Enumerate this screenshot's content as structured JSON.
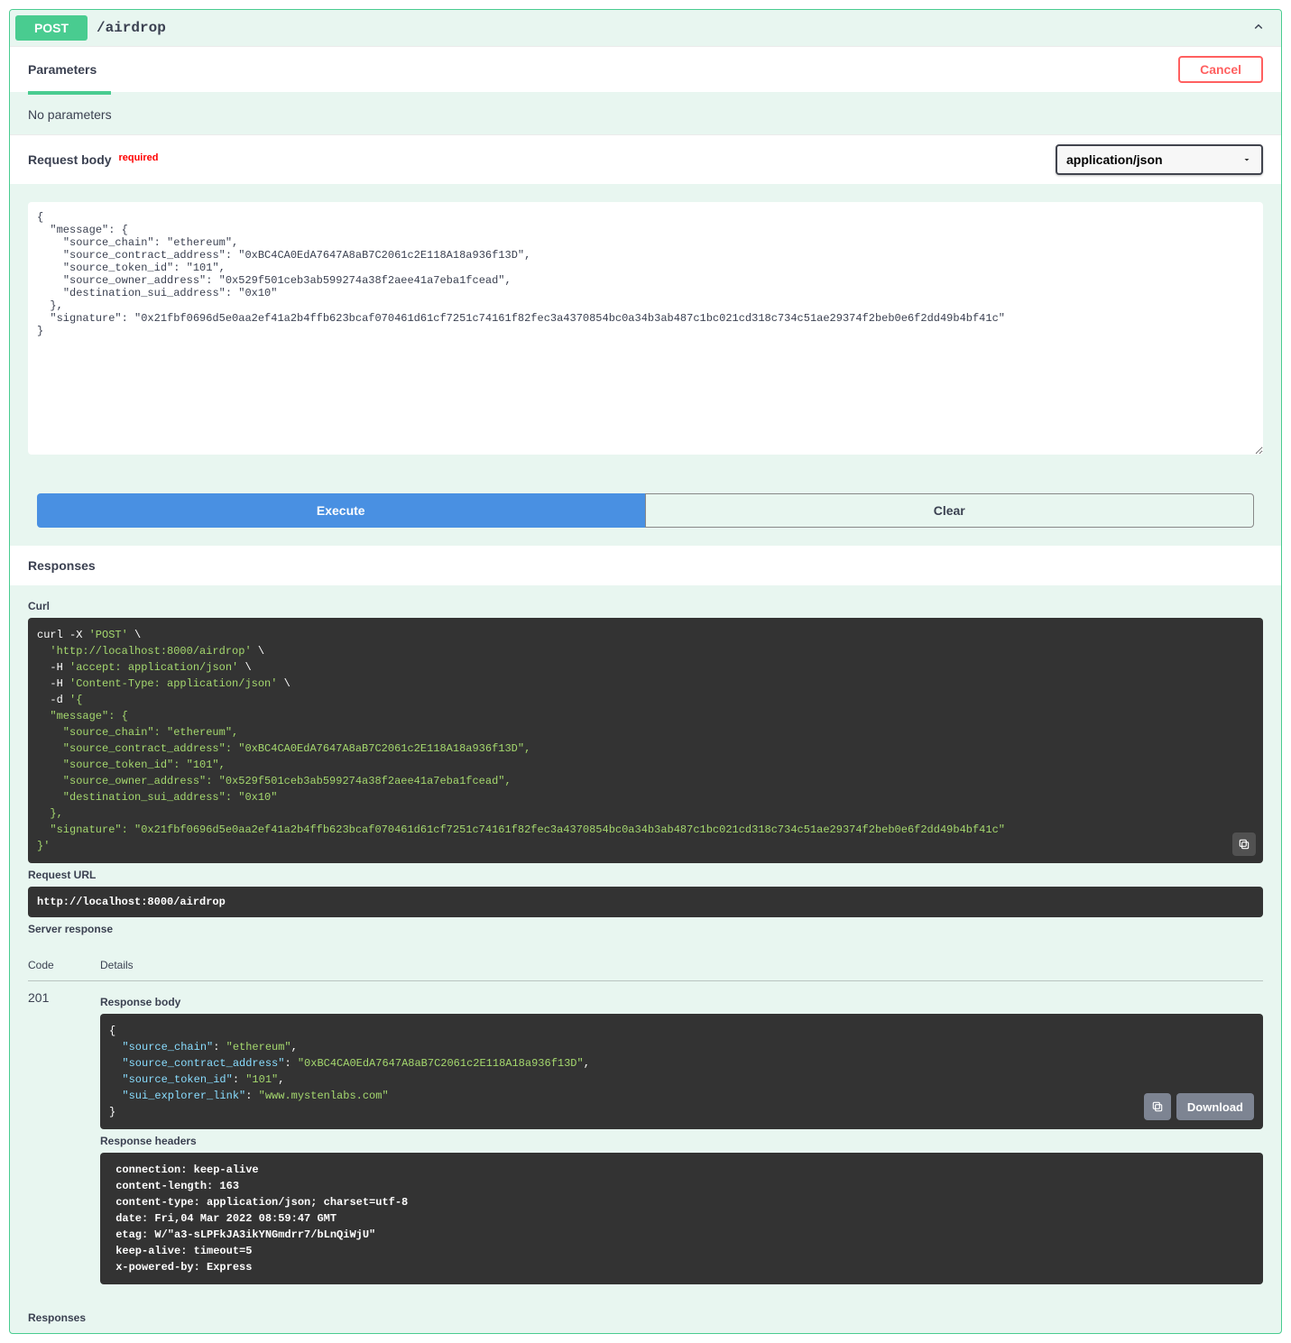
{
  "summary": {
    "method": "POST",
    "path": "/airdrop"
  },
  "parameters": {
    "title": "Parameters",
    "cancel": "Cancel",
    "empty": "No parameters"
  },
  "request_body": {
    "title": "Request body",
    "required": "required",
    "content_type": "application/json",
    "value": "{\n  \"message\": {\n    \"source_chain\": \"ethereum\",\n    \"source_contract_address\": \"0xBC4CA0EdA7647A8aB7C2061c2E118A18a936f13D\",\n    \"source_token_id\": \"101\",\n    \"source_owner_address\": \"0x529f501ceb3ab599274a38f2aee41a7eba1fcead\",\n    \"destination_sui_address\": \"0x10\"\n  },\n  \"signature\": \"0x21fbf0696d5e0aa2ef41a2b4ffb623bcaf070461d61cf7251c74161f82fec3a4370854bc0a34b3ab487c1bc021cd318c734c51ae29374f2beb0e6f2dd49b4bf41c\"\n}"
  },
  "buttons": {
    "execute": "Execute",
    "clear": "Clear"
  },
  "responses_title": "Responses",
  "curl": {
    "label": "Curl",
    "prefix": "curl -X ",
    "method": "'POST'",
    "backslash": " \\",
    "url": "  'http://localhost:8000/airdrop'",
    "h1_pre": "  -H ",
    "h1": "'accept: application/json'",
    "h2_pre": "  -H ",
    "h2": "'Content-Type: application/json'",
    "d_pre": "  -d ",
    "body": "'{\n  \"message\": {\n    \"source_chain\": \"ethereum\",\n    \"source_contract_address\": \"0xBC4CA0EdA7647A8aB7C2061c2E118A18a936f13D\",\n    \"source_token_id\": \"101\",\n    \"source_owner_address\": \"0x529f501ceb3ab599274a38f2aee41a7eba1fcead\",\n    \"destination_sui_address\": \"0x10\"\n  },\n  \"signature\": \"0x21fbf0696d5e0aa2ef41a2b4ffb623bcaf070461d61cf7251c74161f82fec3a4370854bc0a34b3ab487c1bc021cd318c734c51ae29374f2beb0e6f2dd49b4bf41c\"\n}'"
  },
  "request_url": {
    "label": "Request URL",
    "value": "http://localhost:8000/airdrop"
  },
  "server_response": {
    "label": "Server response",
    "code_header": "Code",
    "details_header": "Details",
    "code": "201",
    "body_label": "Response body",
    "body_open": "{",
    "body_k1": "  \"source_chain\"",
    "body_v1": "\"ethereum\"",
    "body_k2": "  \"source_contract_address\"",
    "body_v2": "\"0xBC4CA0EdA7647A8aB7C2061c2E118A18a936f13D\"",
    "body_k3": "  \"source_token_id\"",
    "body_v3": "\"101\"",
    "body_k4": "  \"sui_explorer_link\"",
    "body_v4": "\"www.mystenlabs.com\"",
    "body_close": "}",
    "download": "Download",
    "headers_label": "Response headers",
    "headers": " connection: keep-alive \n content-length: 163 \n content-type: application/json; charset=utf-8 \n date: Fri,04 Mar 2022 08:59:47 GMT \n etag: W/\"a3-sLPFkJA3ikYNGmdrr7/bLnQiWjU\" \n keep-alive: timeout=5 \n x-powered-by: Express "
  },
  "responses_footer": "Responses"
}
